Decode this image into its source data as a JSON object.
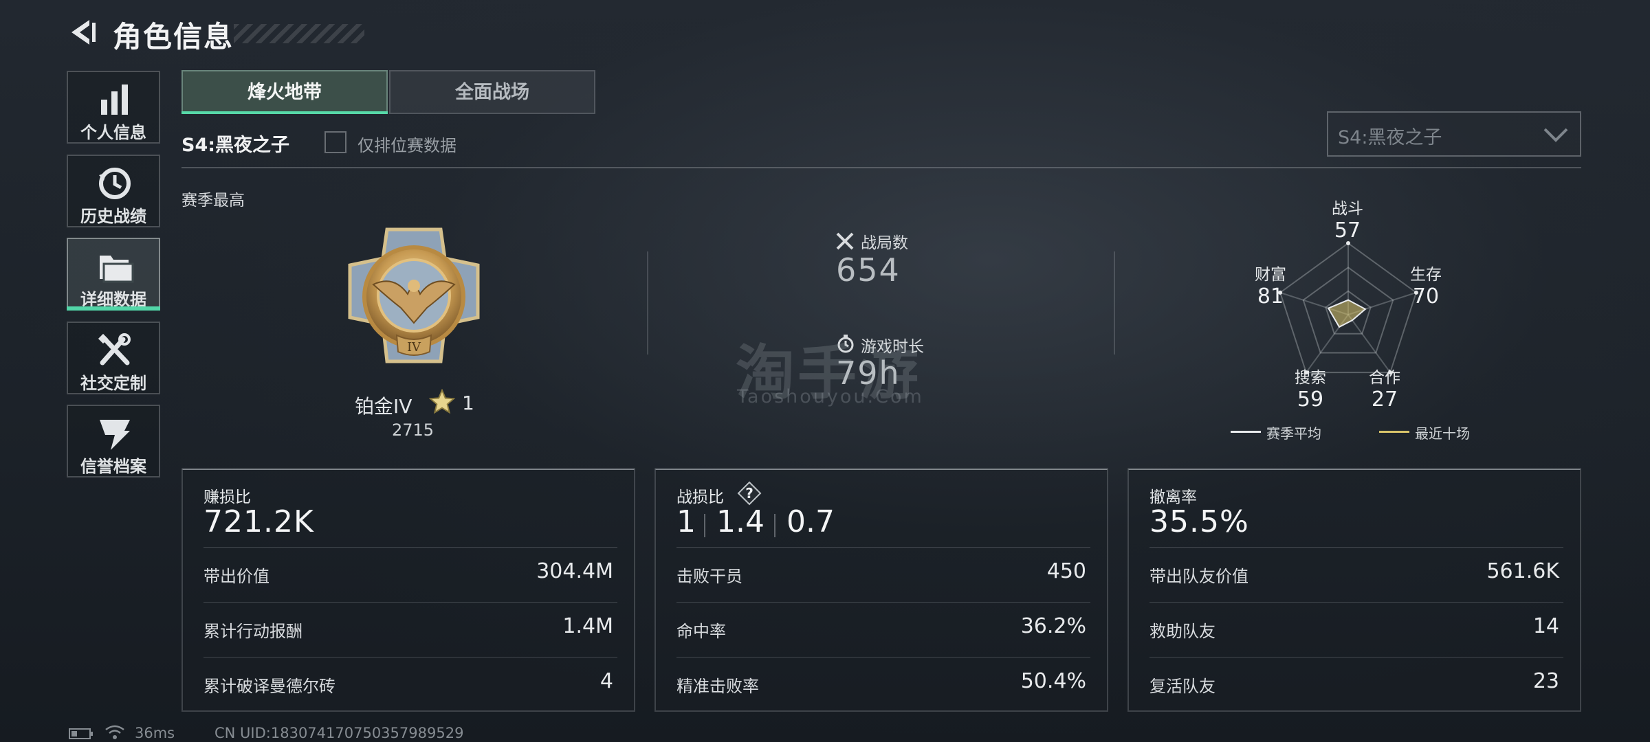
{
  "header": {
    "title": "角色信息"
  },
  "sidebar": {
    "items": [
      {
        "label": "个人信息",
        "icon": "bar-chart-icon"
      },
      {
        "label": "历史战绩",
        "icon": "history-clock-icon"
      },
      {
        "label": "详细数据",
        "icon": "folder-data-icon",
        "active": true
      },
      {
        "label": "社交定制",
        "icon": "tools-icon"
      },
      {
        "label": "信誉档案",
        "icon": "shield-credit-icon"
      }
    ]
  },
  "mode_tabs": [
    {
      "label": "烽火地带",
      "active": true
    },
    {
      "label": "全面战场",
      "active": false
    }
  ],
  "season": {
    "label": "S4:黑夜之子",
    "ranked_only_label": "仅排位赛数据",
    "ranked_only_checked": false,
    "select_value": "S4:黑夜之子"
  },
  "season_best": {
    "heading": "赛季最高",
    "rank_name": "铂金IV",
    "rank_stars": "1",
    "rank_score": "2715",
    "emblem_numeral": "IV"
  },
  "overview": {
    "matches_label": "战局数",
    "matches_value": "654",
    "playtime_label": "游戏时长",
    "playtime_value": "79h"
  },
  "watermark": {
    "cn": "淘手游",
    "en": "Taoshouyou.Com"
  },
  "radar": {
    "axes": [
      {
        "label": "战斗",
        "value": "57"
      },
      {
        "label": "生存",
        "value": "70"
      },
      {
        "label": "合作",
        "value": "27"
      },
      {
        "label": "搜索",
        "value": "59"
      },
      {
        "label": "财富",
        "value": "81"
      }
    ],
    "legend": [
      {
        "label": "赛季平均",
        "color": "#e8eaec"
      },
      {
        "label": "最近十场",
        "color": "#d9c46a"
      }
    ]
  },
  "cards": [
    {
      "title": "赚损比",
      "big": "721.2K",
      "rows": [
        {
          "label": "带出价值",
          "value": "304.4M"
        },
        {
          "label": "累计行动报酬",
          "value": "1.4M"
        },
        {
          "label": "累计破译曼德尔砖",
          "value": "4"
        }
      ]
    },
    {
      "title": "战损比",
      "kd": [
        "1",
        "1.4",
        "0.7"
      ],
      "rows": [
        {
          "label": "击败干员",
          "value": "450"
        },
        {
          "label": "命中率",
          "value": "36.2%"
        },
        {
          "label": "精准击败率",
          "value": "50.4%"
        }
      ]
    },
    {
      "title": "撤离率",
      "big": "35.5%",
      "rows": [
        {
          "label": "带出队友价值",
          "value": "561.6K"
        },
        {
          "label": "救助队友",
          "value": "14"
        },
        {
          "label": "复活队友",
          "value": "23"
        }
      ]
    }
  ],
  "status_bar": {
    "ping": "36ms",
    "uid": "CN UID:18307417075035798​9529"
  }
}
